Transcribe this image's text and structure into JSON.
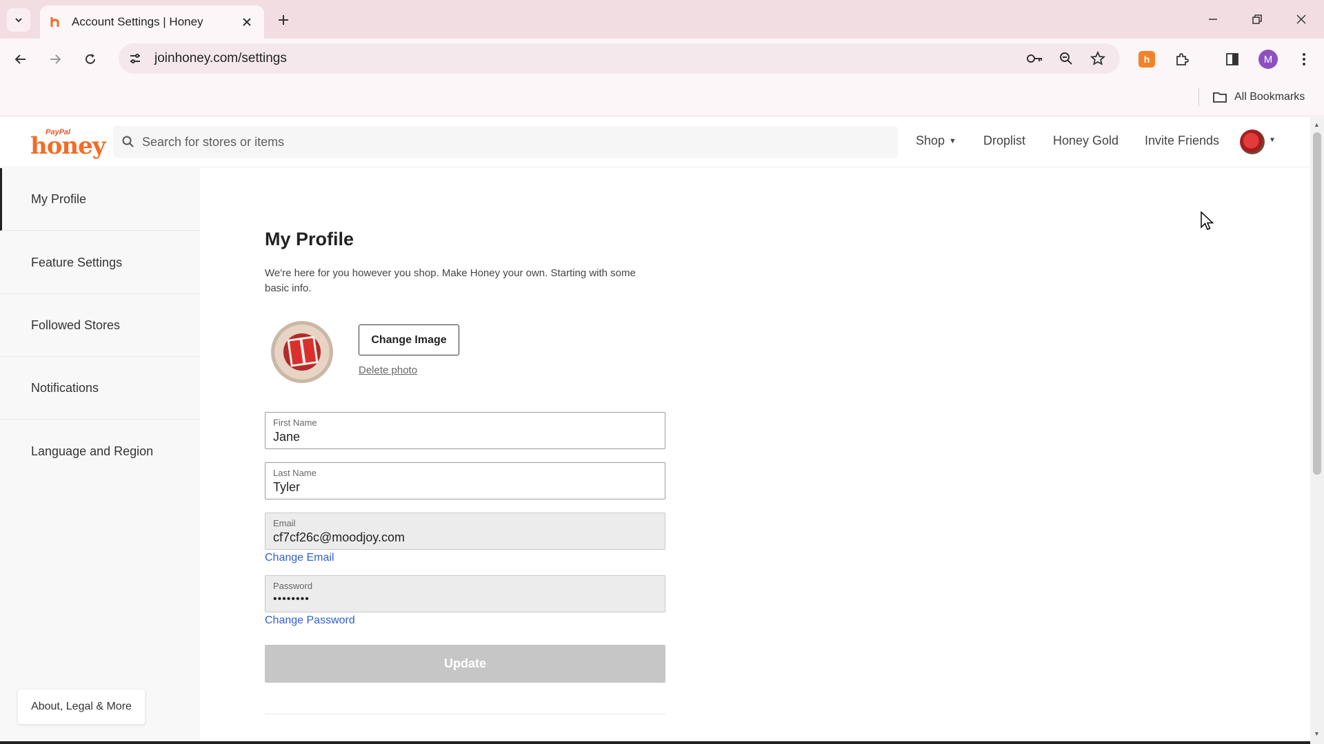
{
  "browser": {
    "tab": {
      "title": "Account Settings | Honey"
    },
    "url": "joinhoney.com/settings",
    "bookmarks": {
      "all_label": "All Bookmarks"
    },
    "profile_initial": "M"
  },
  "header": {
    "logo": {
      "top": "PayPal",
      "main": "honey"
    },
    "search": {
      "placeholder": "Search for stores or items"
    },
    "nav": {
      "shop": "Shop",
      "droplist": "Droplist",
      "honey_gold": "Honey Gold",
      "invite": "Invite Friends"
    }
  },
  "sidebar": {
    "items": [
      {
        "label": "My Profile",
        "active": true
      },
      {
        "label": "Feature Settings"
      },
      {
        "label": "Followed Stores"
      },
      {
        "label": "Notifications"
      },
      {
        "label": "Language and Region"
      }
    ],
    "about": "About, Legal & More"
  },
  "profile": {
    "title": "My Profile",
    "intro": "We're here for you however you shop. Make Honey your own. Starting with some basic info.",
    "change_image": "Change Image",
    "delete_photo": "Delete photo",
    "first_name": {
      "label": "First Name",
      "value": "Jane"
    },
    "last_name": {
      "label": "Last Name",
      "value": "Tyler"
    },
    "email": {
      "label": "Email",
      "value": "cf7cf26c@moodjoy.com"
    },
    "change_email": "Change Email",
    "password": {
      "label": "Password",
      "value": "••••••••"
    },
    "change_password": "Change Password",
    "update": "Update"
  },
  "colors": {
    "brand": "#f26c24",
    "link": "#2f5fd1",
    "tabbar": "#f2dde3"
  }
}
